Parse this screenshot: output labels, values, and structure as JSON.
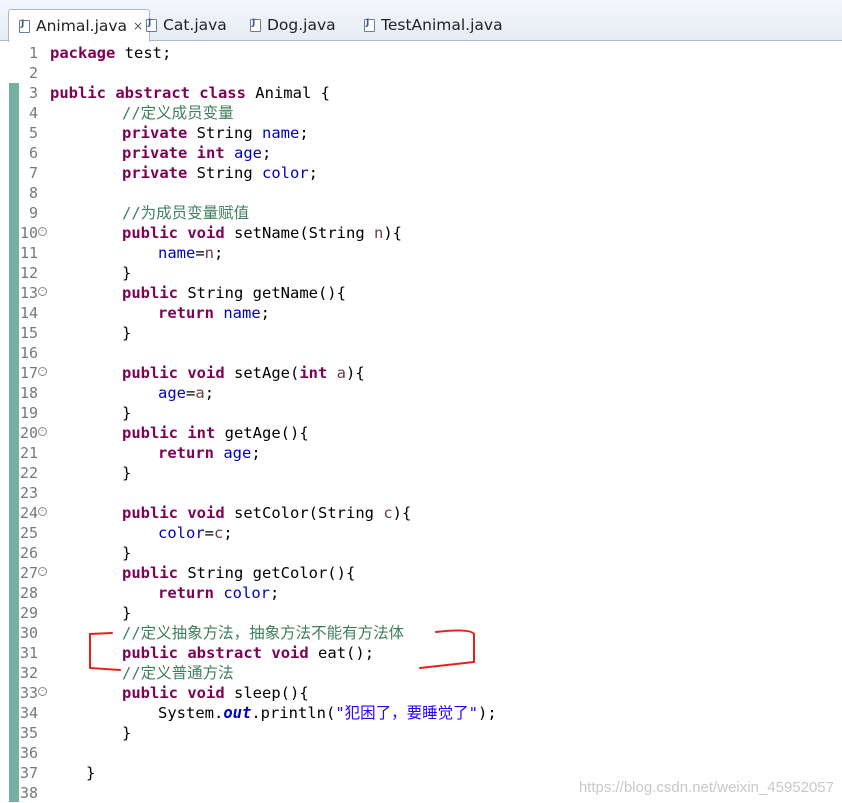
{
  "tabs": [
    {
      "label": "Animal.java",
      "close": "×",
      "active": true
    },
    {
      "label": "Cat.java",
      "active": false
    },
    {
      "label": "Dog.java",
      "active": false
    },
    {
      "label": "TestAnimal.java",
      "active": false
    }
  ],
  "line_numbers": [
    "1",
    "2",
    "3",
    "4",
    "5",
    "6",
    "7",
    "8",
    "9",
    "10",
    "11",
    "12",
    "13",
    "14",
    "15",
    "16",
    "17",
    "18",
    "19",
    "20",
    "21",
    "22",
    "23",
    "24",
    "25",
    "26",
    "27",
    "28",
    "29",
    "30",
    "31",
    "32",
    "33",
    "34",
    "35",
    "36",
    "37",
    "38"
  ],
  "code": {
    "pkg_kw": "package",
    "pkg_name": " test;",
    "class_kw": "public abstract class",
    "class_name": " Animal {",
    "c1": "//定义成员变量",
    "private": "private",
    "string_type": " String ",
    "int_type": " int ",
    "f_name": "name",
    "f_age": "age",
    "f_color": "color",
    "semi": ";",
    "c2": "//为成员变量赋值",
    "public": "public",
    "void": " void ",
    "string_ret": " String ",
    "int_kw": "int",
    "setName": "setName(String ",
    "p_n": "n",
    "close_brace_open": "){",
    "assign": "=",
    "brace": "}",
    "return": "return",
    "getName": "getName(){",
    "setAge": "setAge(",
    "p_a": "a",
    "getAge": "getAge(){",
    "setColor": "setColor(String ",
    "p_c": "c",
    "getColor": "getColor(){",
    "c3": "//定义抽象方法，抽象方法不能有方法体",
    "abstract_kw": " abstract ",
    "eat": "eat();",
    "c4": "//定义普通方法",
    "sleep": "sleep(){",
    "sys": "System.",
    "out": "out",
    "println": ".println(",
    "str": "\"犯困了，要睡觉了\"",
    "end": ");",
    "class_end": "}"
  },
  "watermark": "https://blog.csdn.net/weixin_45952057",
  "colors": {
    "keyword": "#7f0055",
    "field": "#0000c0",
    "comment": "#3f7f5f",
    "string": "#2a00ff",
    "annotation": "#e8201c"
  }
}
